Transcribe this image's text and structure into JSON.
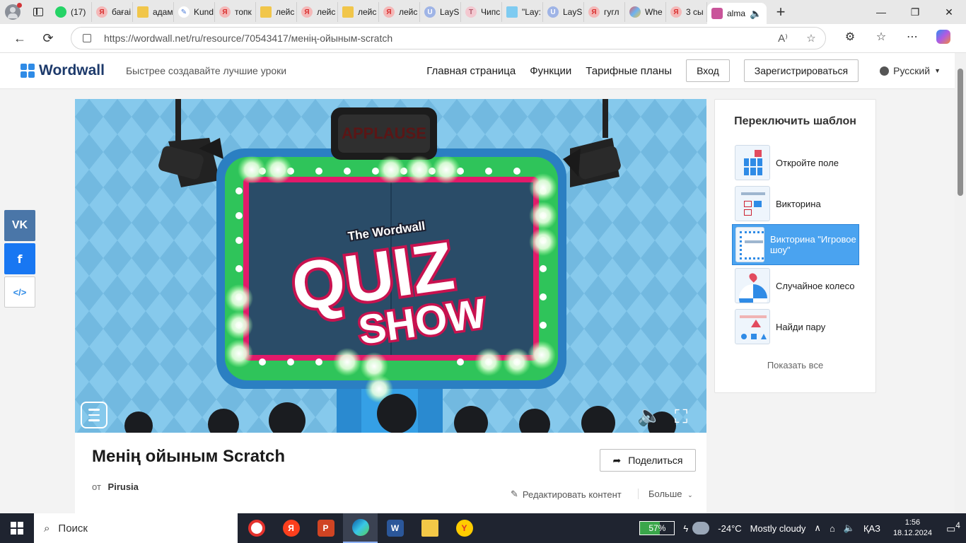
{
  "browser": {
    "tabs": [
      {
        "icon": "whatsapp-icon",
        "label": "(17)"
      },
      {
        "icon": "yandex-icon",
        "label": "бағаі"
      },
      {
        "icon": "image-icon",
        "label": "адам"
      },
      {
        "icon": "kundelik-icon",
        "label": "Kund"
      },
      {
        "icon": "yandex-icon",
        "label": "топк"
      },
      {
        "icon": "image-icon",
        "label": "лейс"
      },
      {
        "icon": "yandex-icon",
        "label": "лейс"
      },
      {
        "icon": "image-icon",
        "label": "лейс"
      },
      {
        "icon": "yandex-icon",
        "label": "лейс"
      },
      {
        "icon": "u-icon",
        "label": "LayS"
      },
      {
        "icon": "t-icon",
        "label": "Чипс"
      },
      {
        "icon": "lays-icon",
        "label": "\"Lay:"
      },
      {
        "icon": "u-icon",
        "label": "LayS"
      },
      {
        "icon": "yandex-icon",
        "label": "гугл"
      },
      {
        "icon": "wheel-icon",
        "label": "Whe"
      },
      {
        "icon": "yandex-icon",
        "label": "3 сы"
      },
      {
        "icon": "alma-icon",
        "label": "alma",
        "active": true
      }
    ],
    "url": "https://wordwall.net/ru/resource/70543417/менің-ойыным-scratch"
  },
  "wordwall": {
    "logo_text": "Wordwall",
    "tagline": "Быстрее создавайте лучшие уроки",
    "nav": {
      "home": "Главная страница",
      "features": "Функции",
      "pricing": "Тарифные планы",
      "login": "Вход",
      "register": "Зарегистрироваться",
      "language": "Русский"
    }
  },
  "game": {
    "sign_text": "APPLAUSE",
    "logo_small": "The Wordwall",
    "logo_quiz": "QUIZ",
    "logo_show": "SHOW"
  },
  "templates": {
    "title": "Переключить шаблон",
    "items": [
      {
        "label": "Откройте поле",
        "thumb": "open-box"
      },
      {
        "label": "Викторина",
        "thumb": "quiz"
      },
      {
        "label": "Викторина \"Игровое шоу\"",
        "thumb": "gameshow",
        "selected": true
      },
      {
        "label": "Случайное колесо",
        "thumb": "wheel"
      },
      {
        "label": "Найди пару",
        "thumb": "find-match"
      }
    ],
    "show_all": "Показать все"
  },
  "activity": {
    "title": "Менің ойыным Scratch",
    "by_label": "от",
    "author": "Pirusia",
    "share_label": "Поделиться",
    "edit_label": "Редактировать контент",
    "more_label": "Больше"
  },
  "share_side": {
    "vk": "VK",
    "fb": "f",
    "embed": "</>"
  },
  "taskbar": {
    "search_placeholder": "Поиск",
    "battery_percent": 57,
    "battery_label": "57%",
    "temperature": "-24°C",
    "weather": "Mostly cloudy",
    "language": "ҚАЗ",
    "time": "1:56",
    "date": "18.12.2024",
    "notification_count": "4"
  }
}
